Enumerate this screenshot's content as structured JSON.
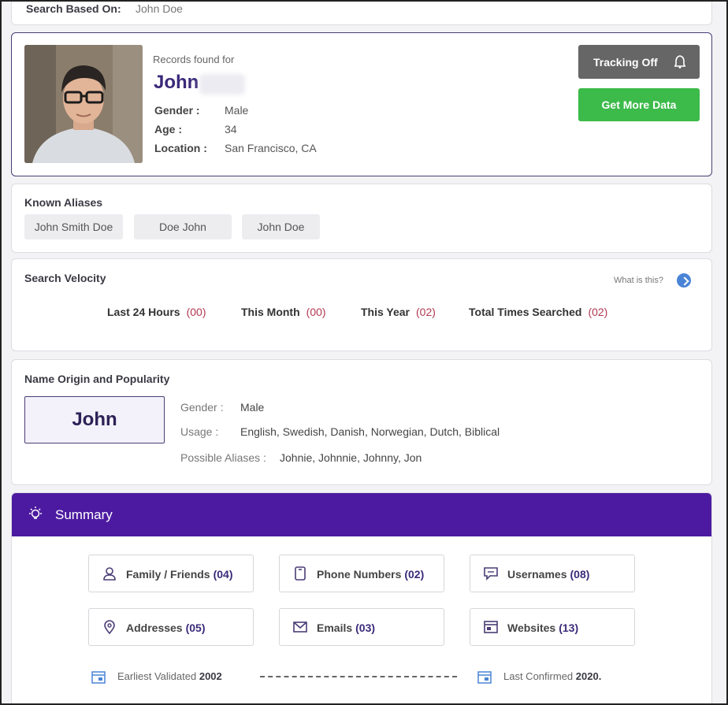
{
  "search": {
    "label": "Search Based On:",
    "value": "John Doe"
  },
  "profile": {
    "records_found_label": "Records found for",
    "first_name": "John",
    "fields": [
      {
        "label": "Gender :",
        "value": "Male"
      },
      {
        "label": "Age :",
        "value": "34"
      },
      {
        "label": "Location :",
        "value": "San Francisco, CA"
      }
    ],
    "tracking_button": "Tracking Off",
    "more_data_button": "Get More Data"
  },
  "aliases": {
    "title": "Known Aliases",
    "items": [
      "John Smith Doe",
      "Doe John",
      "John Doe"
    ]
  },
  "velocity": {
    "title": "Search Velocity",
    "help_text": "What is this?",
    "items": [
      {
        "label": "Last 24 Hours",
        "count": "(00)"
      },
      {
        "label": "This Month",
        "count": "(00)"
      },
      {
        "label": "This Year",
        "count": "(02)"
      },
      {
        "label": "Total Times Searched",
        "count": "(02)"
      }
    ]
  },
  "origin": {
    "title": "Name Origin and Popularity",
    "name": "John",
    "gender_label": "Gender :",
    "gender_value": "Male",
    "usage_label": "Usage :",
    "usage_value": "English, Swedish, Danish, Norwegian, Dutch, Biblical",
    "aliases_label": "Possible Aliases :",
    "aliases_value": "Johnie, Johnnie, Johnny, Jon"
  },
  "summary": {
    "title": "Summary",
    "tiles": [
      {
        "icon": "person-icon",
        "label": "Family / Friends",
        "count": "(04)"
      },
      {
        "icon": "phone-icon",
        "label": "Phone Numbers",
        "count": "(02)"
      },
      {
        "icon": "chat-icon",
        "label": "Usernames",
        "count": "(08)"
      },
      {
        "icon": "map-pin-icon",
        "label": "Addresses",
        "count": "(05)"
      },
      {
        "icon": "envelope-icon",
        "label": "Emails",
        "count": "(03)"
      },
      {
        "icon": "browser-icon",
        "label": "Websites",
        "count": "(13)"
      }
    ],
    "earliest_label": "Earliest Validated",
    "earliest_year": "2002",
    "last_label": "Last Confirmed",
    "last_year": "2020."
  },
  "colors": {
    "accent_purple": "#4c1aa0",
    "button_green": "#3cba4a",
    "button_gray": "#666666",
    "count_red": "#b03a52"
  }
}
